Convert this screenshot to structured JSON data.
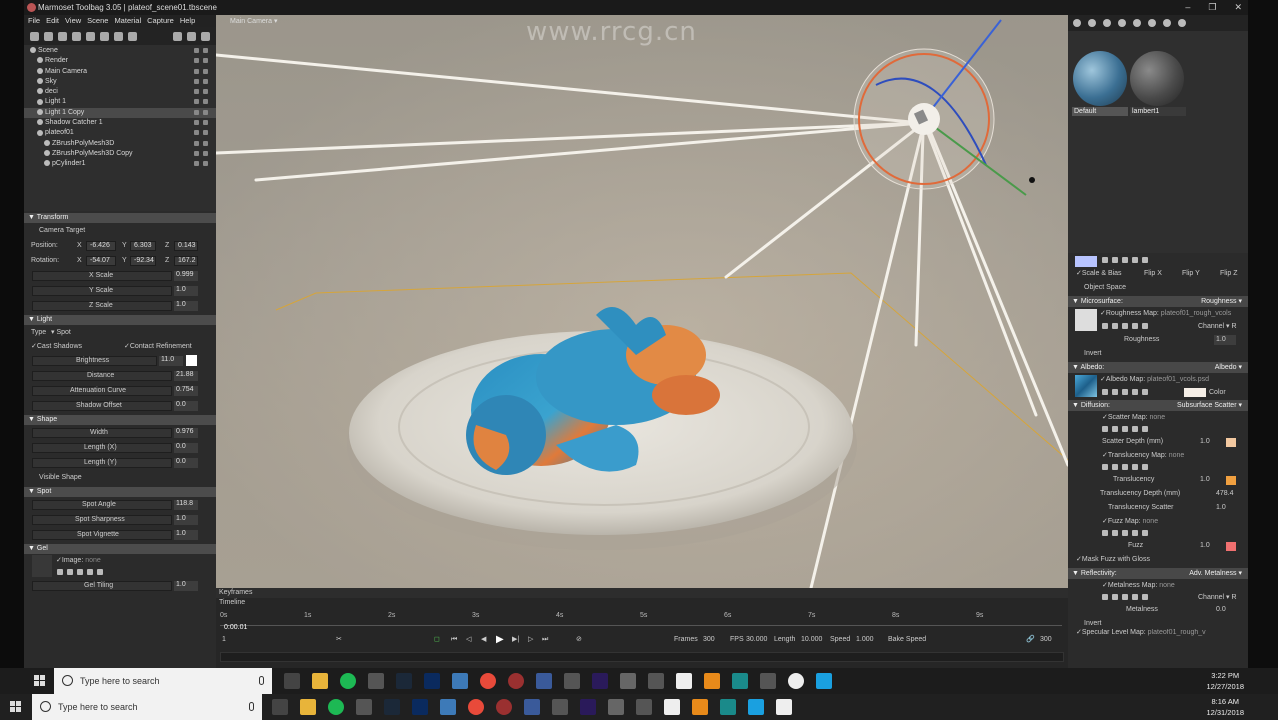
{
  "window": {
    "title": "Marmoset Toolbag 3.05  |  plateof_scene01.tbscene",
    "minimize": "–",
    "maximize": "❐",
    "close": "✕"
  },
  "menu": [
    "File",
    "Edit",
    "View",
    "Scene",
    "Material",
    "Capture",
    "Help"
  ],
  "scene_tree": [
    {
      "label": "Scene",
      "indent": 0,
      "selected": false
    },
    {
      "label": "Render",
      "indent": 1,
      "selected": false
    },
    {
      "label": "Main Camera",
      "indent": 1,
      "selected": false
    },
    {
      "label": "Sky",
      "indent": 1,
      "selected": false
    },
    {
      "label": "deci",
      "indent": 1,
      "selected": false
    },
    {
      "label": "Light 1",
      "indent": 1,
      "selected": false
    },
    {
      "label": "Light 1 Copy",
      "indent": 1,
      "selected": true
    },
    {
      "label": "Shadow Catcher 1",
      "indent": 1,
      "selected": false
    },
    {
      "label": "plateof01",
      "indent": 1,
      "selected": false
    },
    {
      "label": "ZBrushPolyMesh3D",
      "indent": 2,
      "selected": false
    },
    {
      "label": "ZBrushPolyMesh3D Copy",
      "indent": 2,
      "selected": false
    },
    {
      "label": "pCylinder1",
      "indent": 2,
      "selected": false
    }
  ],
  "transform": {
    "header": "Transform",
    "camera_target": "Camera Target",
    "position_label": "Position:",
    "rotation_label": "Rotation:",
    "x": "X",
    "y": "Y",
    "z": "Z",
    "pos_x": "-6.426",
    "pos_y": "6.303",
    "pos_z": "0.143",
    "rot_x": "-54.07",
    "rot_y": "-92.34",
    "rot_z": "167.2",
    "x_scale_label": "X Scale",
    "x_scale": "0.999",
    "y_scale_label": "Y Scale",
    "y_scale": "1.0",
    "z_scale_label": "Z Scale",
    "z_scale": "1.0"
  },
  "light": {
    "header": "Light",
    "type_label": "Type",
    "type_value": "Spot",
    "cast_shadows": "Cast Shadows",
    "contact_refinement": "Contact Refinement",
    "brightness_label": "Brightness",
    "brightness": "11.0",
    "distance_label": "Distance",
    "distance": "21.88",
    "attenuation_label": "Attenuation Curve",
    "attenuation": "0.754",
    "shadow_offset_label": "Shadow Offset",
    "shadow_offset": "0.0"
  },
  "shape": {
    "header": "Shape",
    "width_label": "Width",
    "width": "0.976",
    "length_x_label": "Length (X)",
    "length_x": "0.0",
    "length_y_label": "Length (Y)",
    "length_y": "0.0",
    "visible_shape": "Visible Shape"
  },
  "spot": {
    "header": "Spot",
    "angle_label": "Spot Angle",
    "angle": "118.8",
    "sharpness_label": "Spot Sharpness",
    "sharpness": "1.0",
    "vignette_label": "Spot Vignette",
    "vignette": "1.0"
  },
  "gel": {
    "header": "Gel",
    "image_label": "Image:",
    "image_value": "none",
    "tiling_label": "Gel Tiling",
    "tiling": "1.0"
  },
  "viewport": {
    "camera": "Main Camera ▾",
    "watermark": "www.rrcg.cn"
  },
  "materials": {
    "items": [
      {
        "name": "Default",
        "color": "#3b6f93"
      },
      {
        "name": "lambert1",
        "color": "#5a5a5a"
      }
    ]
  },
  "mat_props": {
    "scale_bias": "Scale & Bias",
    "flip_x": "Flip X",
    "flip_y": "Flip Y",
    "flip_z": "Flip Z",
    "object_space": "Object Space",
    "microsurface": "Microsurface:",
    "roughness_mode": "Roughness",
    "roughness_map_label": "Roughness Map:",
    "roughness_map": "plateof01_rough_vcols",
    "channel_label": "Channel ▾",
    "channel_r": "R",
    "roughness_label": "Roughness",
    "roughness": "1.0",
    "invert": "Invert",
    "albedo": "Albedo:",
    "albedo_mode": "Albedo",
    "albedo_map_label": "Albedo Map:",
    "albedo_map": "plateof01_vcols.psd",
    "color_label": "Color",
    "diffusion": "Diffusion:",
    "diffusion_mode": "Subsurface Scatter",
    "scatter_map_label": "Scatter Map:",
    "scatter_map": "none",
    "scatter_depth_label": "Scatter Depth (mm)",
    "scatter_depth": "1.0",
    "trans_map_label": "Translucency Map:",
    "trans_map": "none",
    "translucency_label": "Translucency",
    "translucency": "1.0",
    "trans_depth_label": "Translucency Depth (mm)",
    "trans_depth": "478.4",
    "trans_scatter_label": "Translucency Scatter",
    "trans_scatter": "1.0",
    "fuzz_map_label": "Fuzz Map:",
    "fuzz_map": "none",
    "fuzz_label": "Fuzz",
    "fuzz": "1.0",
    "mask_fuzz": "Mask Fuzz with Gloss",
    "reflectivity": "Reflectivity:",
    "reflectivity_mode": "Adv. Metalness",
    "metalness_map_label": "Metalness Map:",
    "metalness_map": "none",
    "metalness_label": "Metalness",
    "metalness": "0.0",
    "invert2": "Invert",
    "specular_map_label": "Specular Level Map:",
    "specular_map": "plateof01_rough_v"
  },
  "timeline": {
    "keyframes": "Keyframes",
    "timeline": "Timeline",
    "time": "0:00.01",
    "frame": "1",
    "ticks": [
      "0s",
      "1s",
      "2s",
      "3s",
      "4s",
      "5s",
      "6s",
      "7s",
      "8s",
      "9s"
    ],
    "frames_label": "Frames",
    "frames": "300",
    "fps_label": "FPS",
    "fps": "30.000",
    "length_label": "Length",
    "length": "10.000",
    "speed_label": "Speed",
    "speed": "1.000",
    "bake_speed": "Bake Speed",
    "end": "300"
  },
  "taskbar1": {
    "search": "Type here to search",
    "time": "3:22 PM",
    "date": "12/27/2018"
  },
  "taskbar2": {
    "search": "Type here to search",
    "time": "8:16 AM",
    "date": "12/31/2018"
  },
  "colors": {
    "accent_orange": "#e8893a",
    "selection": "#4a4a4a",
    "panel": "#2b2b2b"
  }
}
